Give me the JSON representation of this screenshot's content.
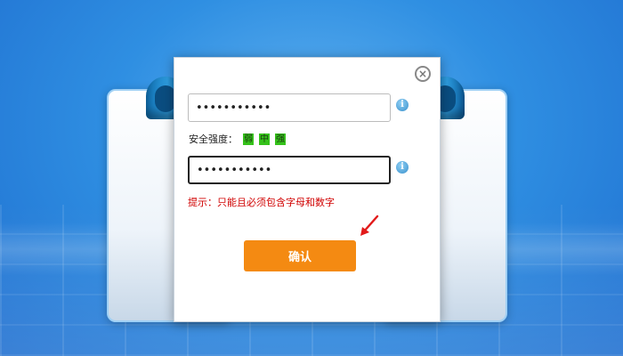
{
  "dialog": {
    "password_mask": "•••••••••••",
    "confirm_mask": "•••••••••••",
    "info_symbol": "i",
    "close_symbol": "×",
    "strength_label": "安全强度：",
    "strength_levels": [
      "弱",
      "中",
      "强"
    ],
    "hint_text": "提示：只能且必须包含字母和数字",
    "confirm_label": "确认"
  },
  "colors": {
    "accent_button": "#f48a12",
    "strength_active": "#35c21a",
    "hint": "#d00000",
    "background": "#2f8fe2"
  },
  "icons": [
    "close-icon",
    "info-icon",
    "red-arrow-annotation"
  ]
}
